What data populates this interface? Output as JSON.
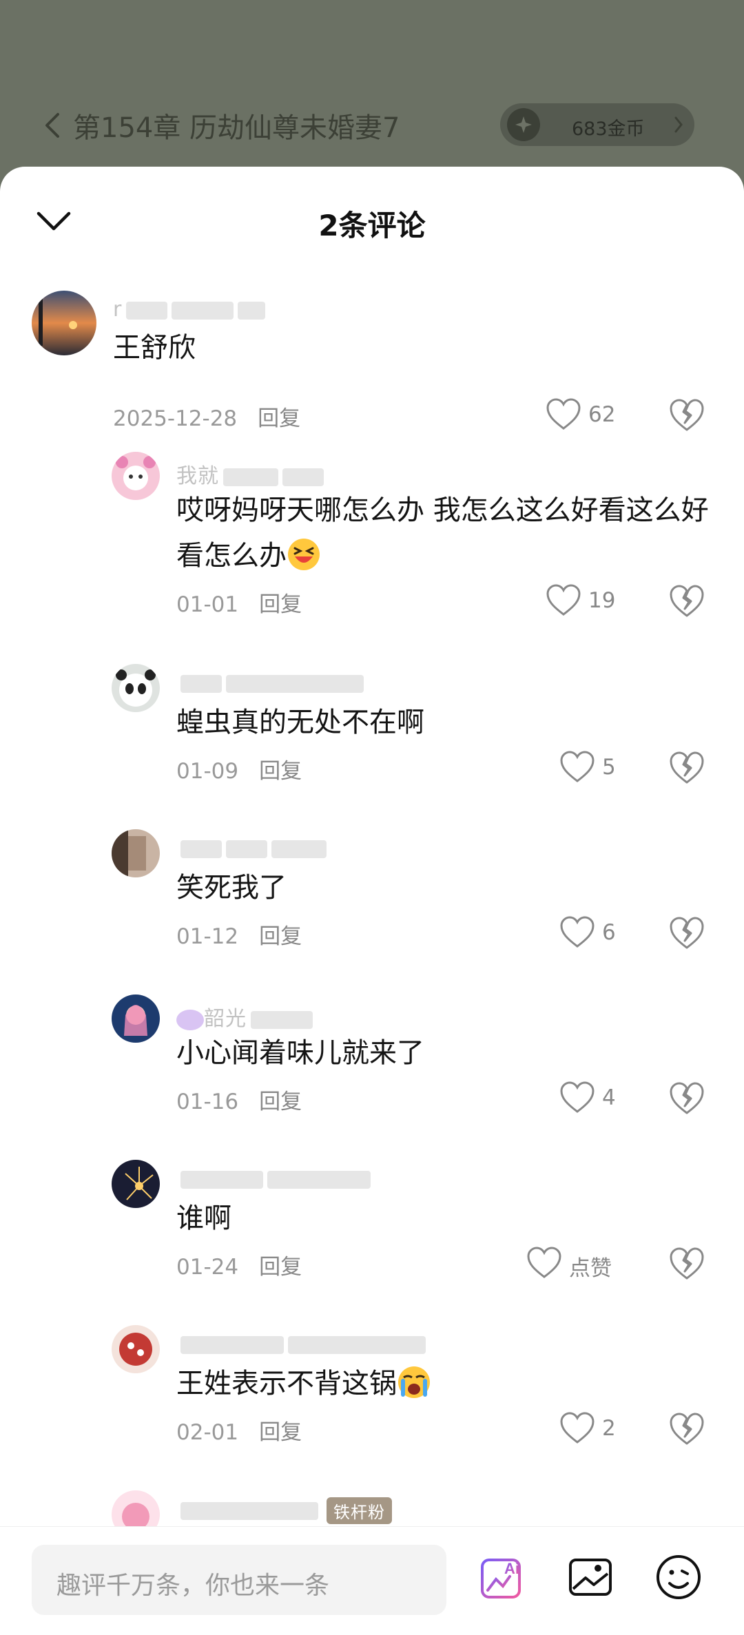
{
  "reader": {
    "chapter_title": "第154章 历劫仙尊未婚妻7",
    "coins": "683金币"
  },
  "sheet": {
    "title": "2条评论"
  },
  "comments": [
    {
      "username": "r",
      "text": "王舒欣",
      "date": "2025-12-28",
      "reply_label": "回复",
      "likes": "62"
    }
  ],
  "replies": [
    {
      "username": "我就",
      "text": "哎呀妈呀天哪怎么办 我怎么这么好看这么好看怎么办",
      "emoji": "laughing-face",
      "date": "01-01",
      "reply_label": "回复",
      "likes": "19"
    },
    {
      "username": "",
      "text": "蝗虫真的无处不在啊",
      "date": "01-09",
      "reply_label": "回复",
      "likes": "5"
    },
    {
      "username": "",
      "text": "笑死我了",
      "date": "01-12",
      "reply_label": "回复",
      "likes": "6"
    },
    {
      "username": "韶光",
      "text": "小心闻着味儿就来了",
      "date": "01-16",
      "reply_label": "回复",
      "likes": "4"
    },
    {
      "username": "",
      "text": "谁啊",
      "date": "01-24",
      "reply_label": "回复",
      "likes": "点赞"
    },
    {
      "username": "",
      "text": "王姓表示不背这锅",
      "emoji": "crying-face",
      "date": "02-01",
      "reply_label": "回复",
      "likes": "2"
    },
    {
      "username": "",
      "badge": "铁杆粉"
    }
  ],
  "input": {
    "placeholder": "趣评千万条，你也来一条"
  },
  "icons": {
    "ai": "ai-icon",
    "image": "image-icon",
    "emoji": "emoji-icon"
  },
  "colors": {
    "overlay": "#6b7164",
    "ai_gradient_start": "#7a5cf5",
    "ai_gradient_end": "#f05aa0"
  }
}
